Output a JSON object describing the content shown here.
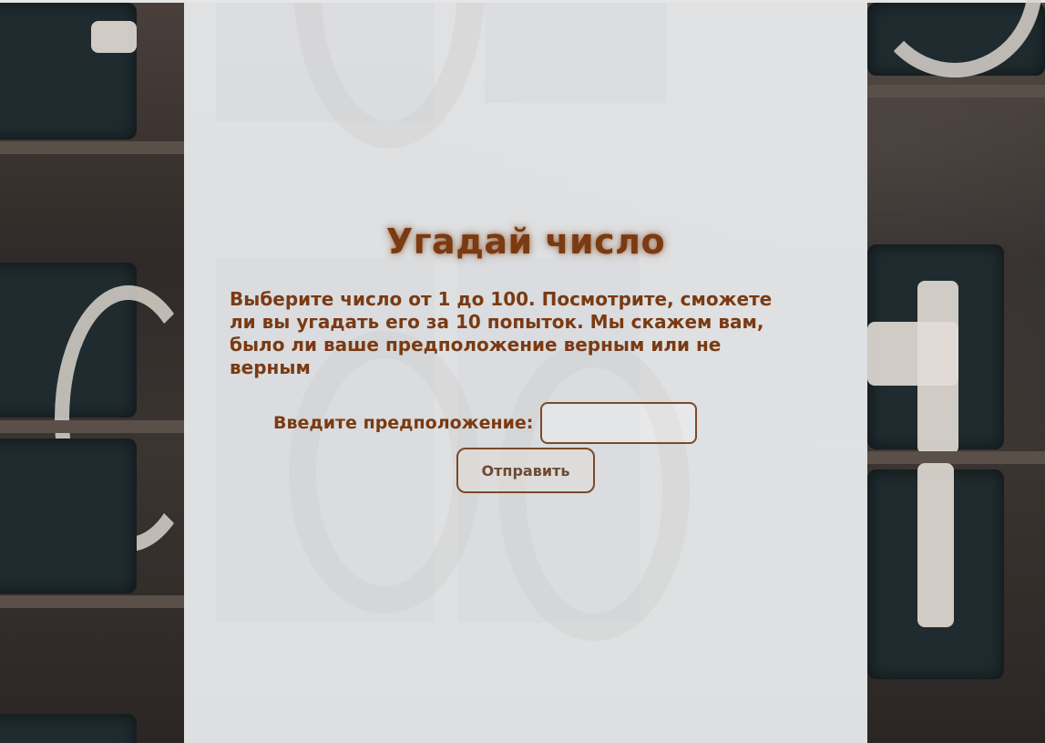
{
  "game": {
    "title": "Угадай число",
    "intro": "Выберите число от 1 до 100. Посмотрите, сможете ли вы угадать его за 10 попыток. Мы скажем вам, было ли ваше предположение верным или не верным",
    "guess_label": "Введите предположение:",
    "guess_value": "",
    "guess_placeholder": "",
    "submit_label": "Отправить"
  },
  "colors": {
    "text": "#7a3a12",
    "panel": "#eceef0",
    "border": "#7a4a2a"
  }
}
